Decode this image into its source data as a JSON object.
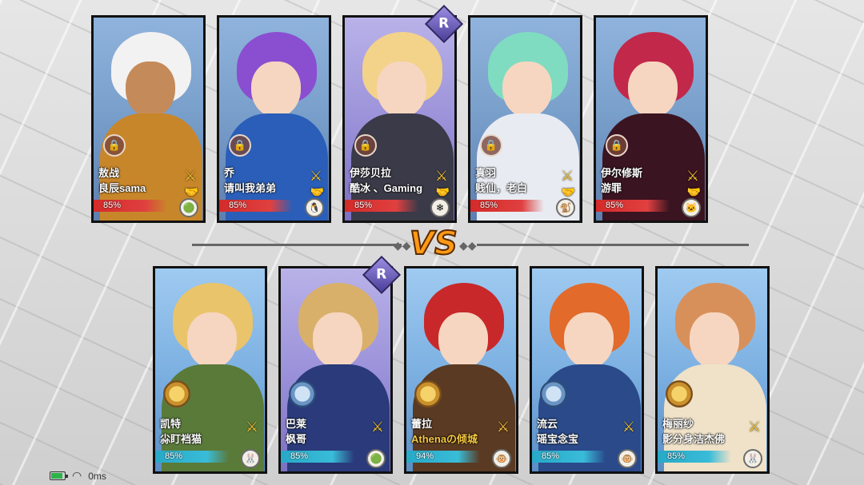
{
  "top_team": [
    {
      "hero": "敖战",
      "player": "良辰sama",
      "progress": "85%",
      "hair": "#f2f2f2",
      "body": "#c8862a",
      "avatar": "🟢"
    },
    {
      "hero": "乔",
      "player": "请叫我弟弟",
      "progress": "85%",
      "hair": "#8a4ed0",
      "body": "#2a5eb8",
      "avatar": "🐧"
    },
    {
      "hero": "伊莎贝拉",
      "player": "酷冰 、Gaming",
      "progress": "85%",
      "hair": "#f3d28a",
      "body": "#3a3a48",
      "avatar": "❄"
    },
    {
      "hero": "真羽",
      "player": "贱仙，老白",
      "progress": "85%",
      "hair": "#7fdcc0",
      "body": "#e8ecf2",
      "avatar": "🐒"
    },
    {
      "hero": "伊尔修斯",
      "player": "游罪",
      "progress": "85%",
      "hair": "#c2284a",
      "body": "#3a1420",
      "avatar": "🐱"
    }
  ],
  "bottom_team": [
    {
      "hero": "凯特",
      "player": "尛盯裆猫",
      "progress": "85%",
      "hair": "#eac46a",
      "body": "#5a7a3a",
      "avatar": "🐰",
      "player_color": "white"
    },
    {
      "hero": "巴莱",
      "player": "枫哥",
      "progress": "85%",
      "hair": "#d9b06a",
      "body": "#2a3a7a",
      "avatar": "🟢",
      "player_color": "white"
    },
    {
      "hero": "蕾拉",
      "player": "Athenaの倾城",
      "progress": "94%",
      "hair": "#c8282a",
      "body": "#5a3a22",
      "avatar": "🐵",
      "player_color": "gold"
    },
    {
      "hero": "流云",
      "player": "瑶宝念宝",
      "progress": "85%",
      "hair": "#e26a2a",
      "body": "#2a4a8a",
      "avatar": "🐵",
      "player_color": "white"
    },
    {
      "hero": "梅丽纱",
      "player": "影分身洁杰佛",
      "progress": "85%",
      "hair": "#d8905a",
      "body": "#efe2c8",
      "avatar": "🐰",
      "player_color": "white"
    }
  ],
  "vs_label": "VS",
  "rank_badge": "R",
  "status": {
    "ping": "0ms"
  },
  "colors": {
    "top_bar": "#d42a2a",
    "bottom_bar": "#27a9c7",
    "vs": "#ff9a14"
  }
}
